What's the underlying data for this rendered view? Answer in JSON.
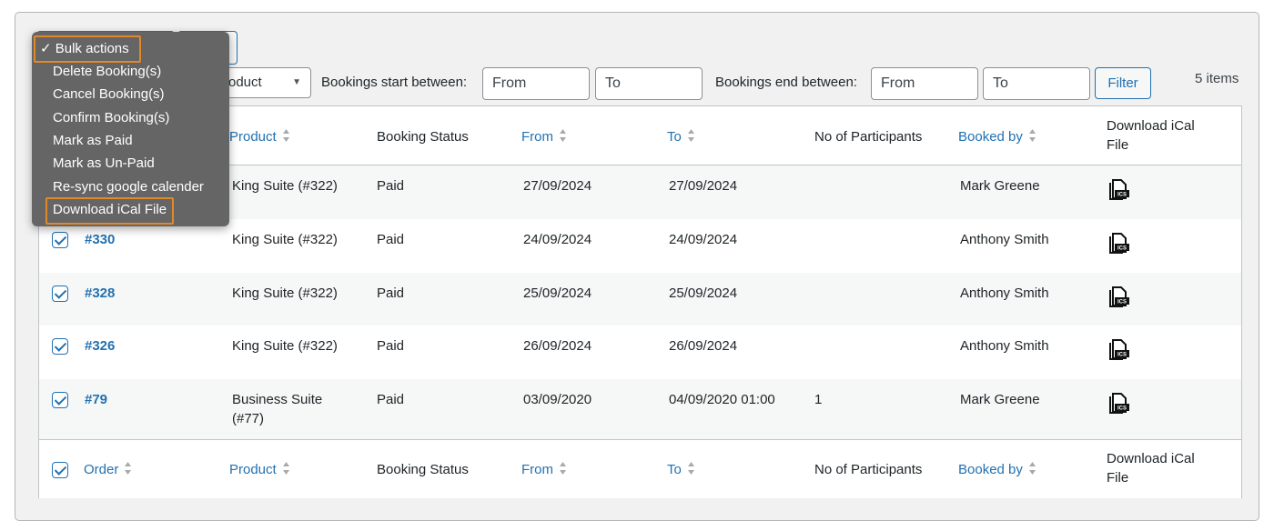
{
  "bulk_actions": {
    "selected": "Bulk actions",
    "check": "✓",
    "options": [
      "Bulk actions",
      "Delete Booking(s)",
      "Cancel Booking(s)",
      "Confirm Booking(s)",
      "Mark as Paid",
      "Mark as Un-Paid",
      "Re-sync google calender",
      "Download iCal File"
    ]
  },
  "filters": {
    "product_select": "oduct",
    "start_label": "Bookings start between:",
    "end_label": "Bookings end between:",
    "from_placeholder": "From",
    "to_placeholder": "To",
    "filter_button": "Filter",
    "items_count": "5 items"
  },
  "table": {
    "columns": {
      "order": "Order",
      "product": "Product",
      "status": "Booking Status",
      "from": "From",
      "to": "To",
      "participants": "No of Participants",
      "booked_by": "Booked by",
      "ical_line1": "Download iCal",
      "ical_line2": "File"
    },
    "rows": [
      {
        "order": "",
        "product": "King Suite (#322)",
        "product2": "",
        "status": "Paid",
        "from": "27/09/2024",
        "to": "27/09/2024",
        "participants": "",
        "booked_by": "Mark Greene"
      },
      {
        "order": "#330",
        "product": "King Suite (#322)",
        "product2": "",
        "status": "Paid",
        "from": "24/09/2024",
        "to": "24/09/2024",
        "participants": "",
        "booked_by": "Anthony Smith"
      },
      {
        "order": "#328",
        "product": "King Suite (#322)",
        "product2": "",
        "status": "Paid",
        "from": "25/09/2024",
        "to": "25/09/2024",
        "participants": "",
        "booked_by": "Anthony Smith"
      },
      {
        "order": "#326",
        "product": "King Suite (#322)",
        "product2": "",
        "status": "Paid",
        "from": "26/09/2024",
        "to": "26/09/2024",
        "participants": "",
        "booked_by": "Anthony Smith"
      },
      {
        "order": "#79",
        "product": "Business Suite",
        "product2": "(#77)",
        "status": "Paid",
        "from": "03/09/2020",
        "to": "04/09/2020 01:00",
        "participants": "1",
        "booked_by": "Mark Greene"
      }
    ],
    "ics_icon": "ics-file-icon",
    "ics_text": "ICS"
  },
  "colors": {
    "link": "#2271b1",
    "highlight": "#e0892b",
    "dropdown_bg": "#656565"
  }
}
